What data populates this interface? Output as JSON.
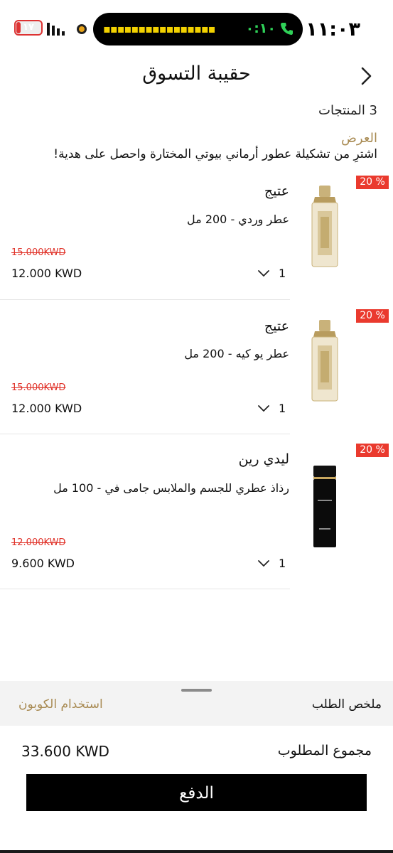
{
  "status_bar": {
    "time": "١١:٠٣",
    "call_timer": "٠:١٠",
    "battery_level": "١٧",
    "battery_fraction": 0.17,
    "phone_icon": "phone-icon",
    "signal_icon": "signal-bars-icon"
  },
  "header": {
    "title": "حقيبة التسوق",
    "back_icon": "chevron-right-icon"
  },
  "cart": {
    "count_label": "3 المنتجات",
    "offer_title": "العرض",
    "offer_text": "اشترِ من تشكيلة عطور أرماني بيوتي المختارة واحصل على هدية!"
  },
  "items": [
    {
      "badge": "20 %",
      "brand": "عتيج",
      "name": "عطر وردي - 200 مل",
      "old_price": "15.000KWD",
      "price": "12.000 KWD",
      "qty": "1",
      "image_icon": "gold-perfume-bottle-icon"
    },
    {
      "badge": "20 %",
      "brand": "عتيج",
      "name": "عطر يو كيه - 200 مل",
      "old_price": "15.000KWD",
      "price": "12.000 KWD",
      "qty": "1",
      "image_icon": "gold-perfume-bottle-icon"
    },
    {
      "badge": "20 %",
      "brand": "ليدي رين",
      "name": "رذاذ عطري للجسم والملابس جامى في - 100 مل",
      "old_price": "12.000KWD",
      "price": "9.600 KWD",
      "qty": "1",
      "image_icon": "black-spray-bottle-icon"
    }
  ],
  "summary": {
    "label": "ملخص الطلب",
    "coupon": "استخدام الكوبون",
    "total_label": "مجموع المطلوب",
    "total_value": "33.600 KWD",
    "pay_label": "الدفع"
  },
  "colors": {
    "accent_gold": "#a88a52",
    "discount_red": "#ea3a2e",
    "strike_red": "#e0332a",
    "button_black": "#000000"
  }
}
